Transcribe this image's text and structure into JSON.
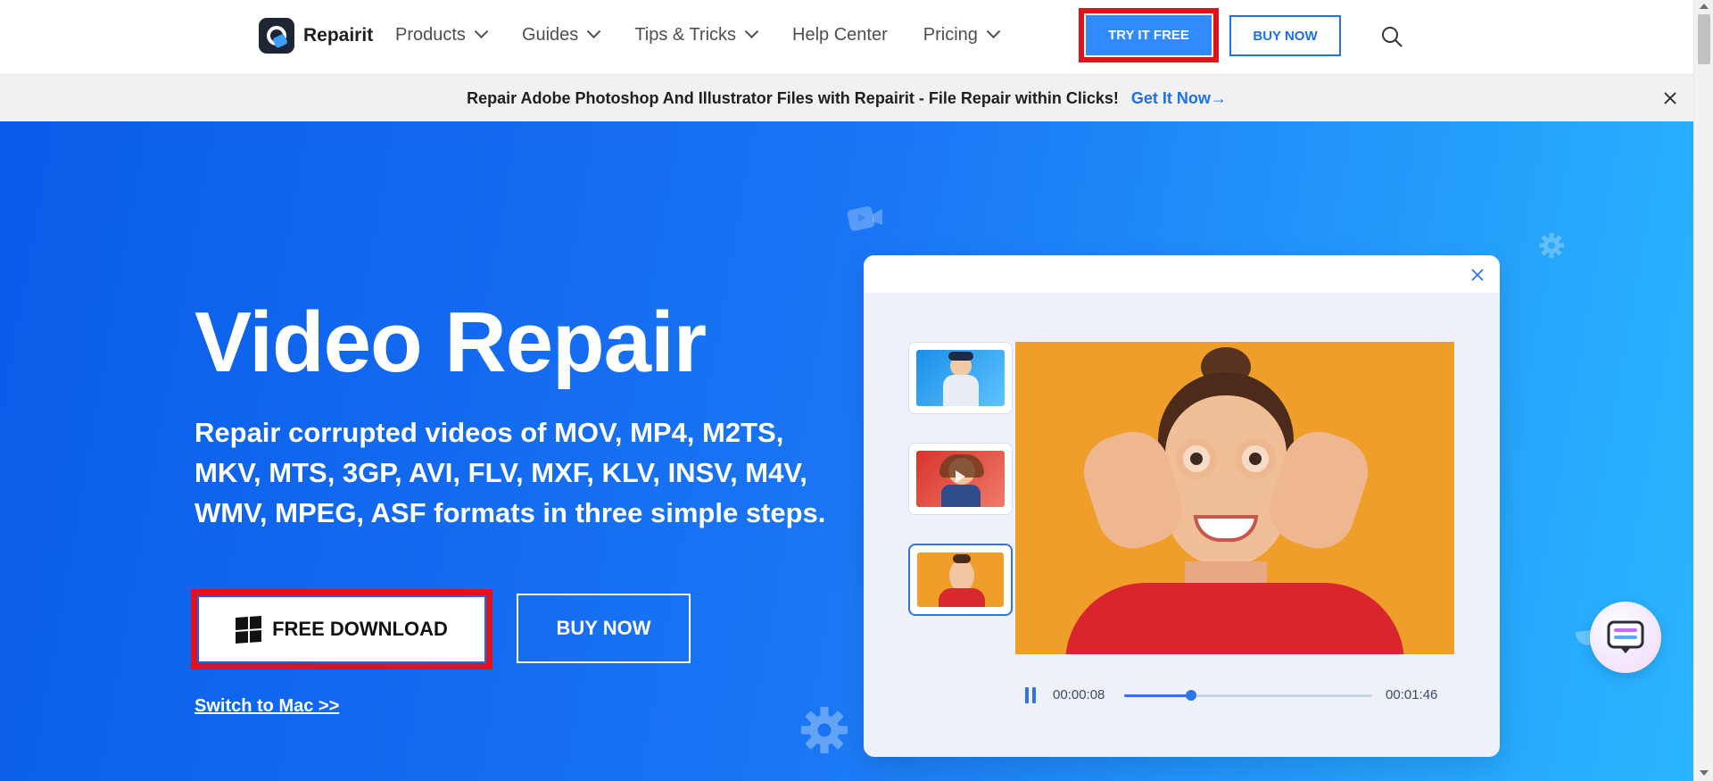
{
  "nav": {
    "logo_text": "Repairit",
    "menu": [
      {
        "label": "Products",
        "has_dropdown": true
      },
      {
        "label": "Guides",
        "has_dropdown": true
      },
      {
        "label": "Tips & Tricks",
        "has_dropdown": true
      },
      {
        "label": "Help Center",
        "has_dropdown": false
      },
      {
        "label": "Pricing",
        "has_dropdown": true
      }
    ],
    "try_label": "TRY IT FREE",
    "buy_label": "BUY NOW",
    "search_icon": "search-icon"
  },
  "banner": {
    "text": "Repair Adobe Photoshop And Illustrator Files with Repairit - File Repair within Clicks!",
    "link": "Get It Now→",
    "close_icon": "close-icon"
  },
  "hero": {
    "title": "Video Repair",
    "subtitle": "Repair corrupted videos of MOV, MP4, M2TS, MKV, MTS, 3GP, AVI, FLV, MXF, KLV, INSV, M4V, WMV, MPEG, ASF formats in three simple steps.",
    "download_label": "FREE DOWNLOAD",
    "download_icon": "windows-icon",
    "buy_label": "BUY NOW",
    "switch_link": "Switch to Mac >>"
  },
  "player": {
    "current_time": "00:00:08",
    "duration": "00:01:46",
    "progress": 0.27,
    "selected_thumbnail": 3,
    "thumbnail_count": 3
  },
  "colors": {
    "accent": "#2f8bff",
    "brand_blue": "#1f6fe6",
    "highlight_red": "#e0121d",
    "hero_gradient_start": "#0a5be9",
    "hero_gradient_end": "#2ab6ff"
  }
}
